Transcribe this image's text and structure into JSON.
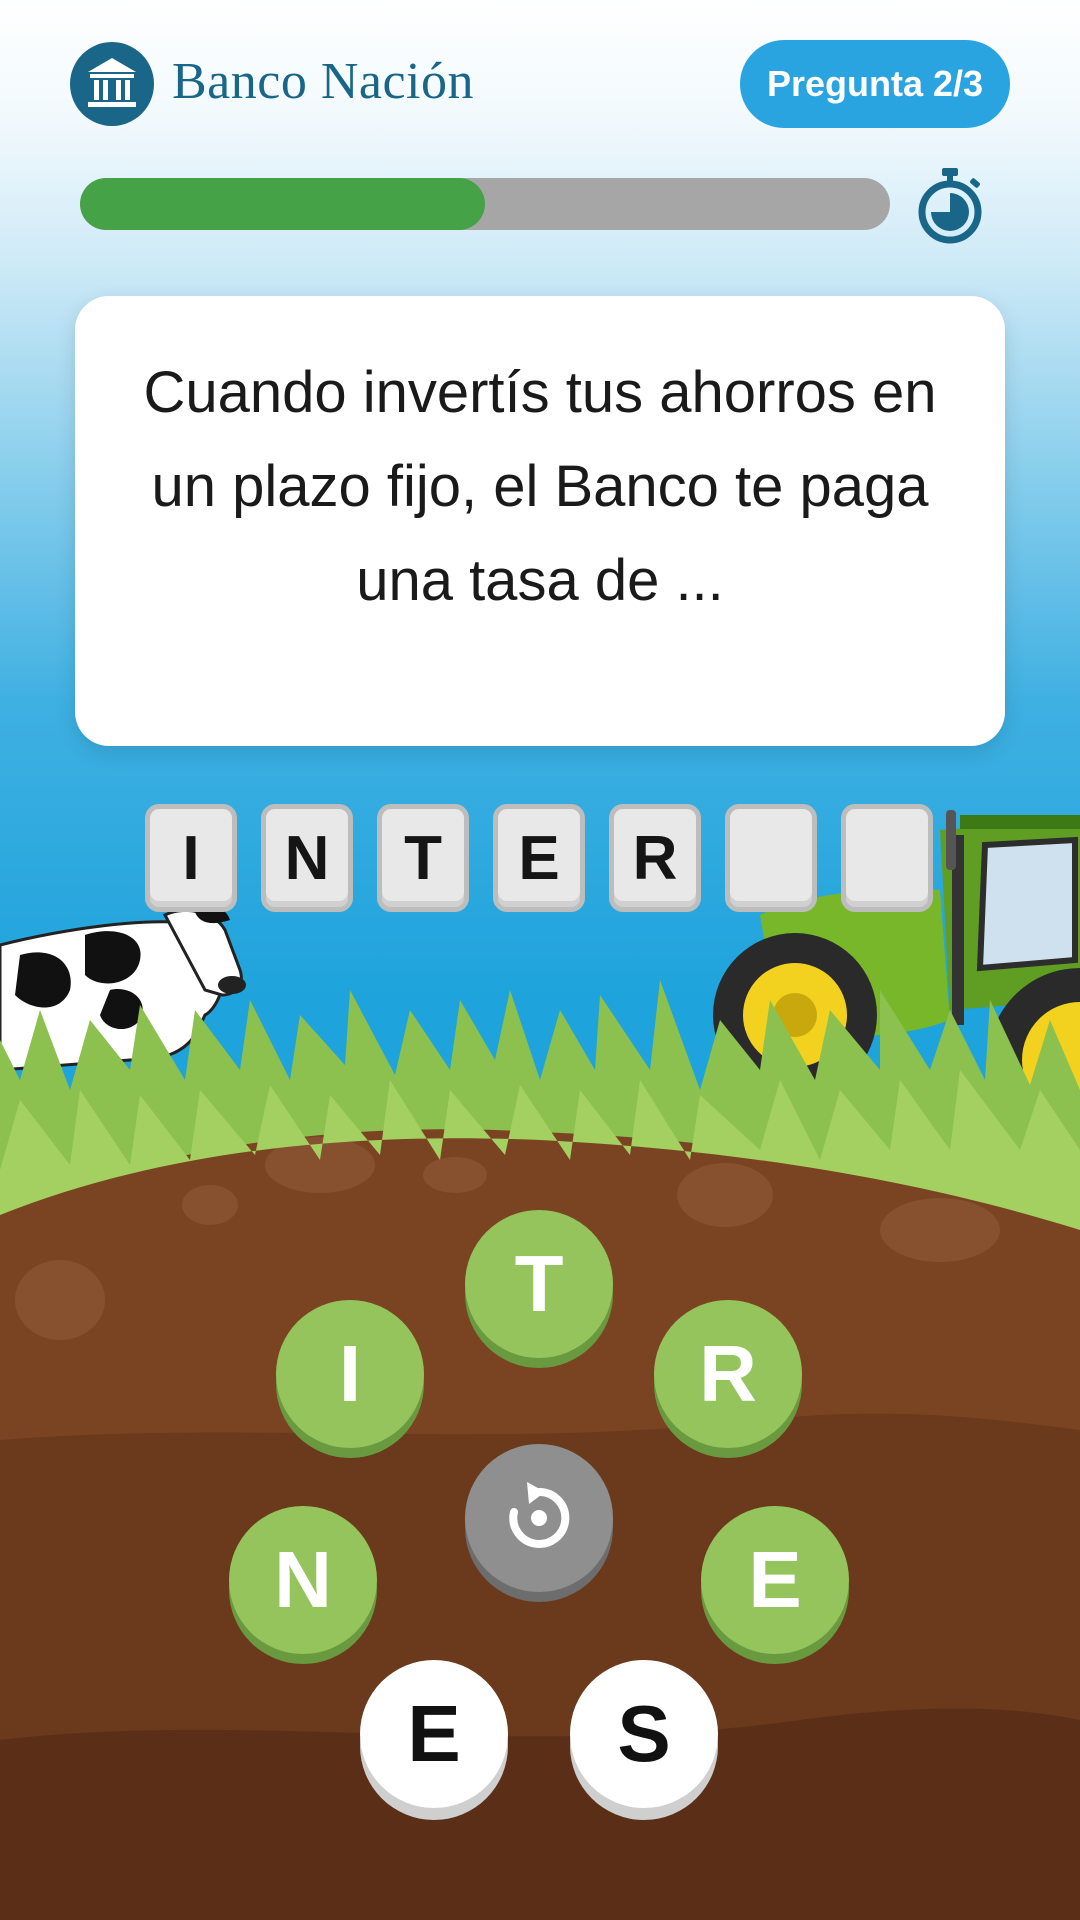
{
  "header": {
    "brand_name": "Banco Nación",
    "question_counter": "Pregunta 2/3",
    "logo_icon": "bank-building-icon",
    "brand_color": "#1a6688",
    "badge_color": "#2aa4e0"
  },
  "progress": {
    "fraction": 0.5,
    "fill_color": "#45a247",
    "track_color": "#a6a6a6",
    "timer_icon": "stopwatch-icon"
  },
  "question": {
    "text": "Cuando invertís tus ahorros en un plazo fijo, el Banco te paga una tasa de ..."
  },
  "answer_slots": [
    "I",
    "N",
    "T",
    "E",
    "R",
    "",
    ""
  ],
  "letter_wheel": {
    "letters": [
      {
        "letter": "T",
        "state": "available"
      },
      {
        "letter": "I",
        "state": "available"
      },
      {
        "letter": "R",
        "state": "available"
      },
      {
        "letter": "N",
        "state": "available"
      },
      {
        "letter": "E",
        "state": "available"
      },
      {
        "letter": "E",
        "state": "remaining"
      },
      {
        "letter": "S",
        "state": "remaining"
      }
    ],
    "reset_icon": "rotate-reset-icon"
  },
  "scene": {
    "left_figure": "cow-illustration",
    "right_figure": "tractor-illustration",
    "grass_color": "#8cc04f",
    "soil_color": "#6e3d20"
  }
}
